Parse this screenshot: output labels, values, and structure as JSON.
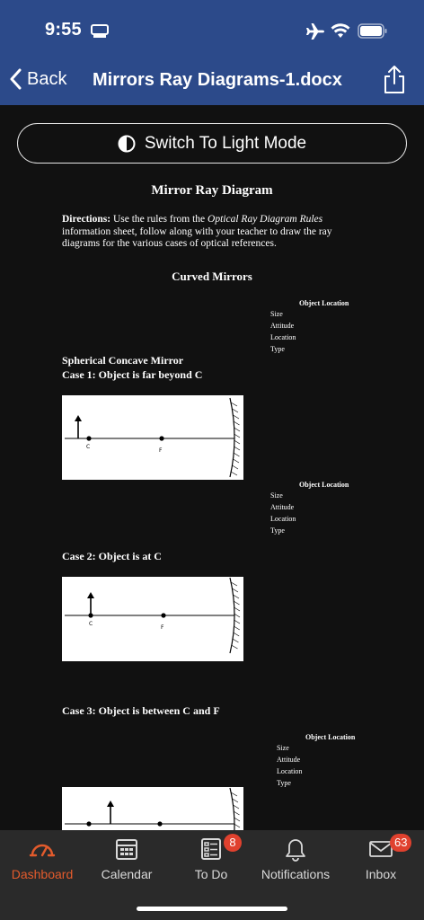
{
  "status_bar": {
    "time": "9:55"
  },
  "nav": {
    "back_label": "Back",
    "title": "Mirrors Ray Diagrams-1.docx"
  },
  "mode_toggle": {
    "label": "Switch To Light Mode"
  },
  "document": {
    "heading": "Mirror Ray Diagram",
    "directions_label": "Directions:",
    "directions_pre": " Use the rules from the ",
    "directions_italic": "Optical Ray Diagram Rules",
    "directions_post": " information sheet, follow along with your teacher to draw the ray diagrams for the various cases of optical references.",
    "section": "Curved Mirrors",
    "info_head": "Object Location",
    "info_lines": [
      "Size",
      "Attitude",
      "Location",
      "Type"
    ],
    "case1_line1": "Spherical Concave Mirror",
    "case1_line2": "Case 1: Object is far beyond C",
    "case2": "Case 2: Object is at C",
    "case3": "Case 3: Object is between C and F",
    "point_c": "C",
    "point_f": "F"
  },
  "tabs": [
    {
      "label": "Dashboard",
      "icon": "dashboard-gauge-icon",
      "active": true
    },
    {
      "label": "Calendar",
      "icon": "calendar-icon"
    },
    {
      "label": "To Do",
      "icon": "todo-list-icon",
      "badge": "8"
    },
    {
      "label": "Notifications",
      "icon": "bell-icon"
    },
    {
      "label": "Inbox",
      "icon": "envelope-icon",
      "badge": "63"
    }
  ],
  "colors": {
    "header_bg": "#2c4a8a",
    "content_bg": "#111111",
    "tabbar_bg": "#2a2a2a",
    "accent": "#e35b2c",
    "badge": "#e0412e"
  }
}
